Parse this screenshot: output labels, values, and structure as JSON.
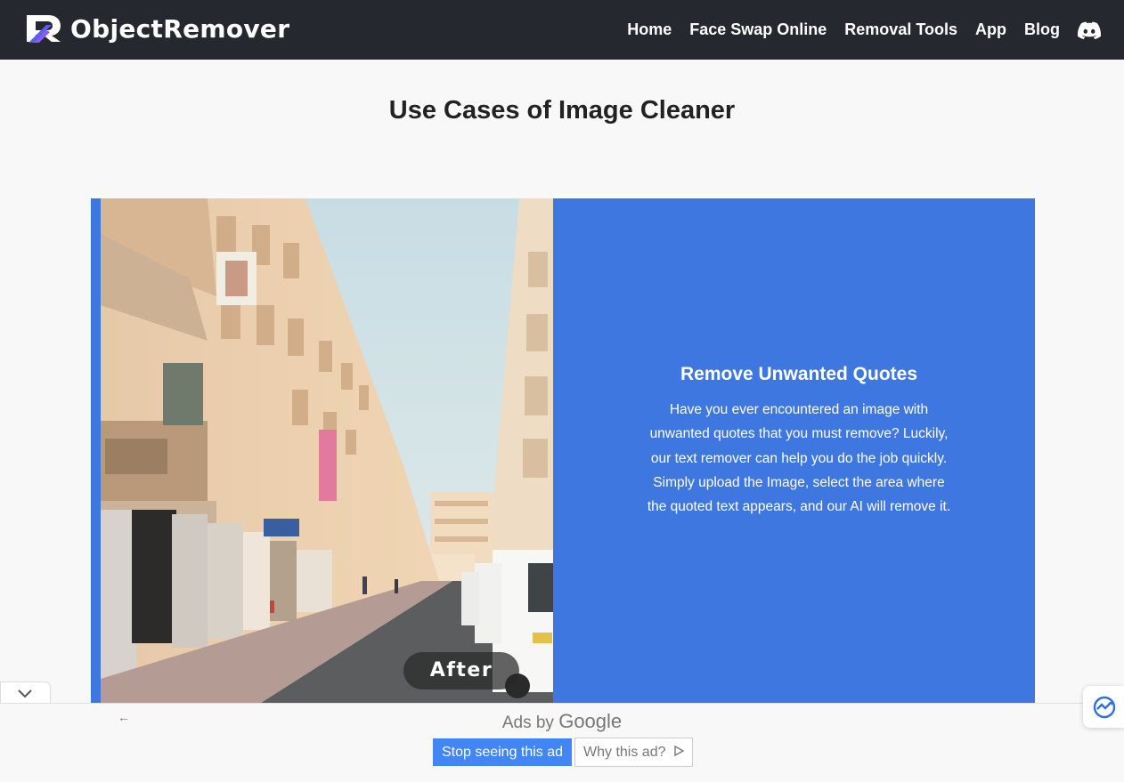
{
  "brand": {
    "name": "ObjectRemover",
    "logo_icon": "objectremover-r-logo-icon"
  },
  "nav": {
    "links": [
      "Home",
      "Face Swap Online",
      "Removal Tools",
      "App",
      "Blog"
    ],
    "discord_icon": "discord-icon"
  },
  "section": {
    "title": "Use Cases of Image Cleaner"
  },
  "card": {
    "image_label": "After",
    "heading": "Remove Unwanted Quotes",
    "body": "Have you ever encountered an image with unwanted quotes that you must remove? Luckily, our text remover can help you do the job quickly. Simply upload the Image, select the area where the quoted text appears, and our AI will remove it.",
    "accent_color": "#3f77e0"
  },
  "ad": {
    "ads_by": "Ads by",
    "google": "Google",
    "stop_label": "Stop seeing this ad",
    "why_label": "Why this ad?",
    "collapse_icon": "chevron-down-icon",
    "back_icon": "arrow-left-icon"
  },
  "floating_widget": {
    "icon": "chat-widget-icon"
  }
}
